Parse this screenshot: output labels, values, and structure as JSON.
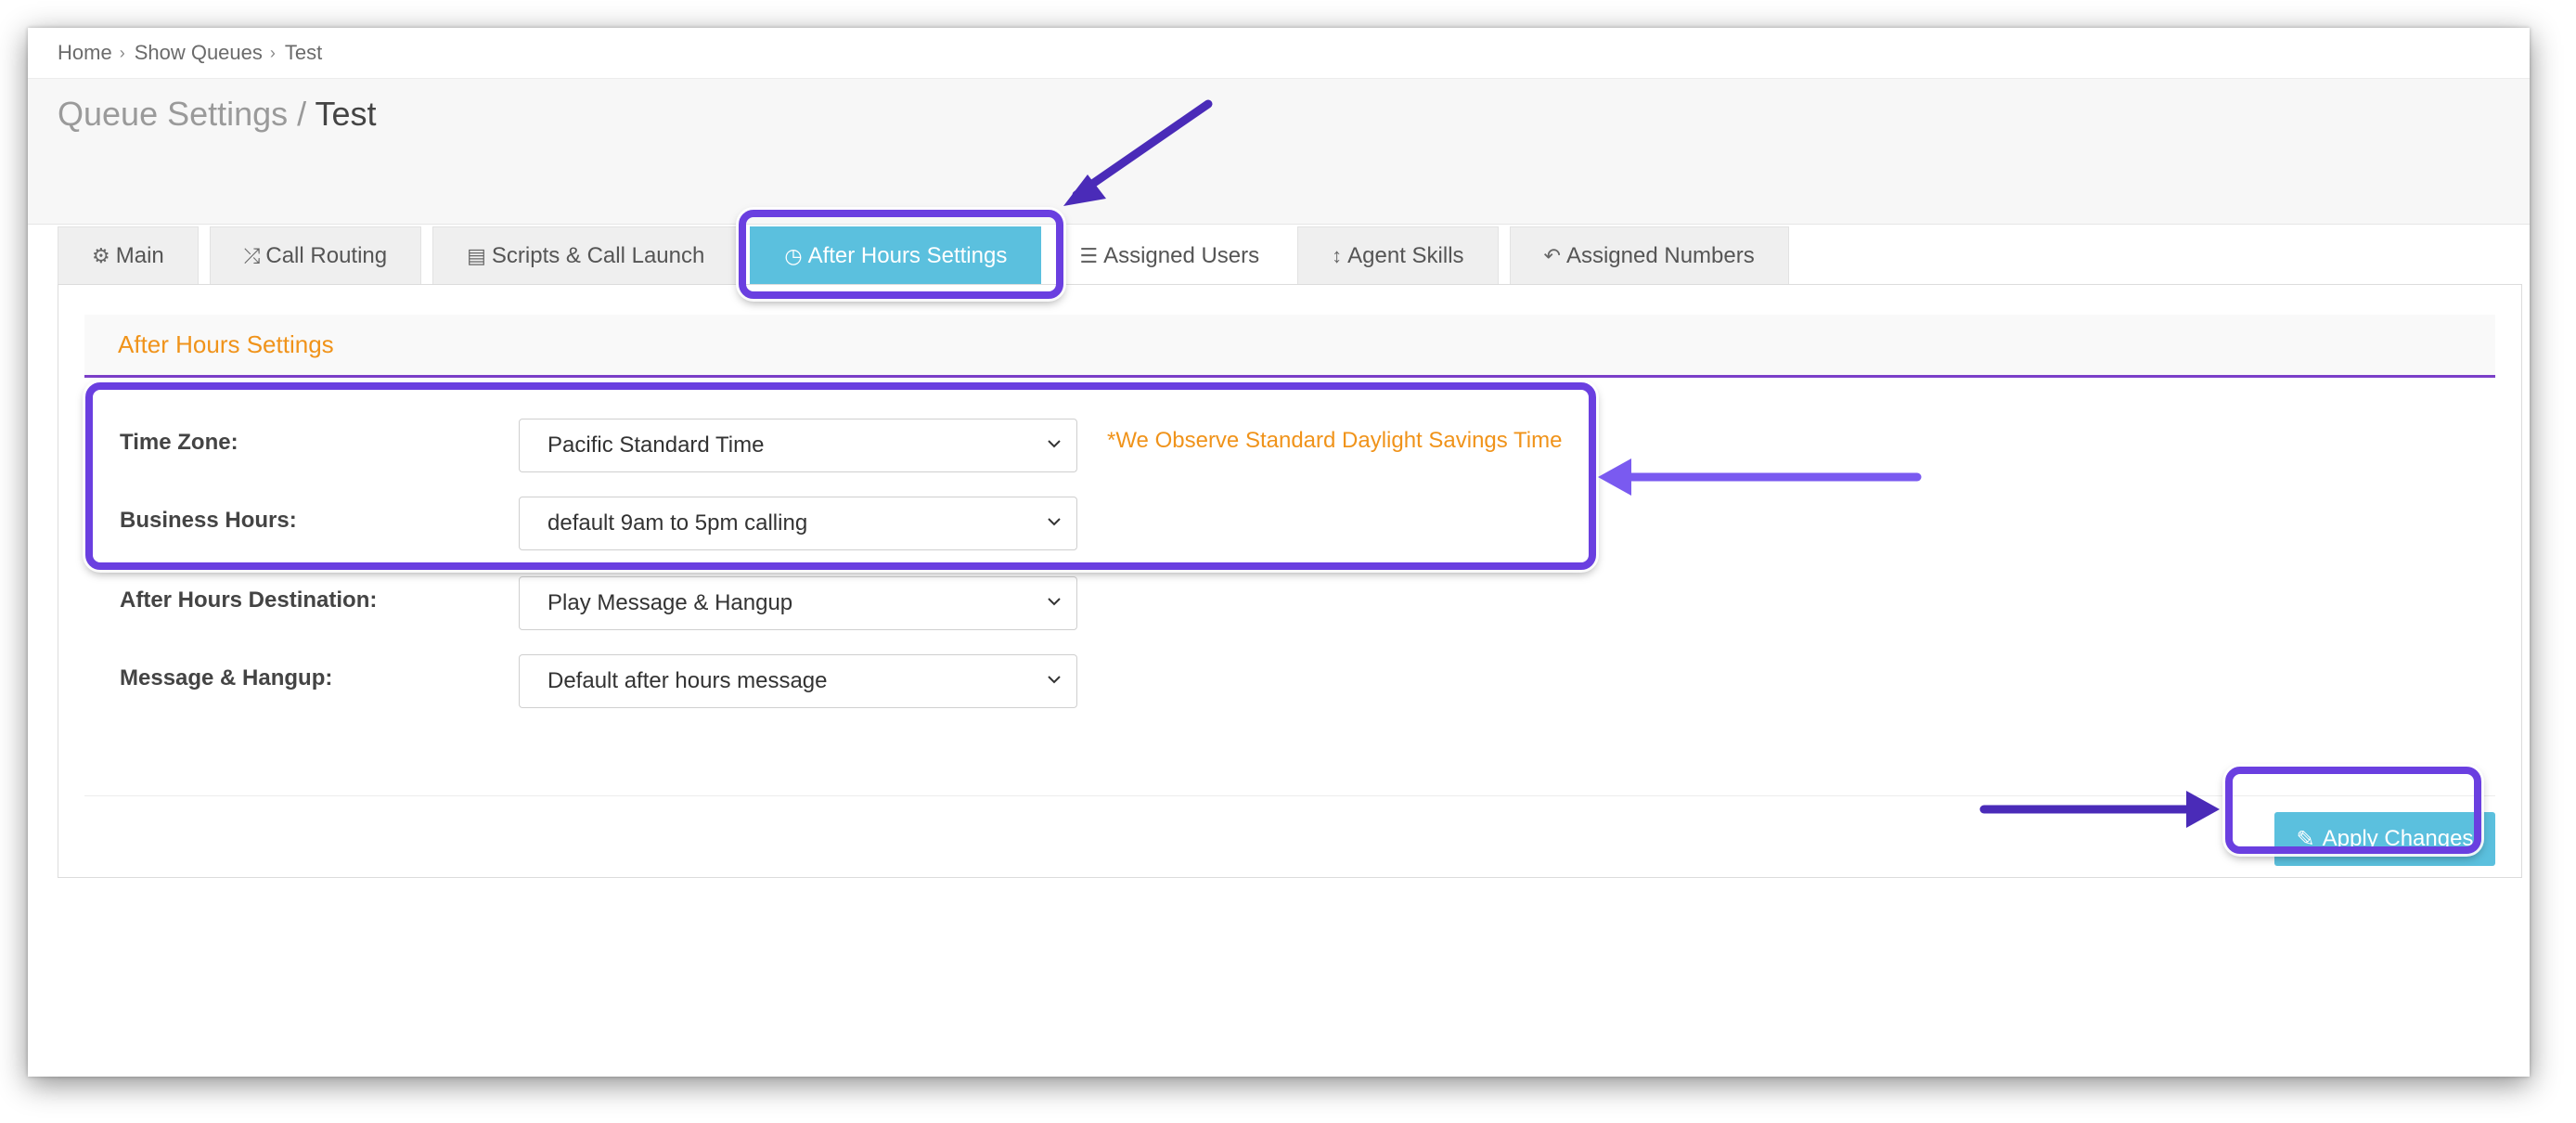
{
  "breadcrumb": {
    "items": [
      "Home",
      "Show Queues",
      "Test"
    ]
  },
  "title": {
    "section": "Queue Settings",
    "separator": " / ",
    "current": "Test"
  },
  "tabs": [
    {
      "label": "Main",
      "icon": "gear-icon",
      "active": false
    },
    {
      "label": "Call Routing",
      "icon": "shuffle-icon",
      "active": false
    },
    {
      "label": "Scripts & Call Launch",
      "icon": "newspaper-icon",
      "active": false
    },
    {
      "label": "After Hours Settings",
      "icon": "clock-icon",
      "active": true
    },
    {
      "label": "Assigned Users",
      "icon": "ordered-list-icon",
      "active": false
    },
    {
      "label": "Agent Skills",
      "icon": "vertical-resize-icon",
      "active": false
    },
    {
      "label": "Assigned Numbers",
      "icon": "reply-all-icon",
      "active": false
    }
  ],
  "section": {
    "title": "After Hours Settings"
  },
  "form": {
    "time_zone": {
      "label": "Time Zone:",
      "value": "Pacific Standard Time"
    },
    "business_hours": {
      "label": "Business Hours:",
      "value": "default 9am to 5pm calling"
    },
    "after_hours_destination": {
      "label": "After Hours Destination:",
      "value": "Play Message & Hangup"
    },
    "message_hangup": {
      "label": "Message & Hangup:",
      "value": "Default after hours message"
    },
    "dst_note": "*We Observe Standard Daylight Savings Time"
  },
  "actions": {
    "apply_label": "Apply Changes",
    "apply_icon": "edit-icon"
  },
  "colors": {
    "accent": "#5bc0de",
    "orange": "#f0931a",
    "section_rule": "#7b3fc8",
    "highlight": "#6a3fe0"
  }
}
